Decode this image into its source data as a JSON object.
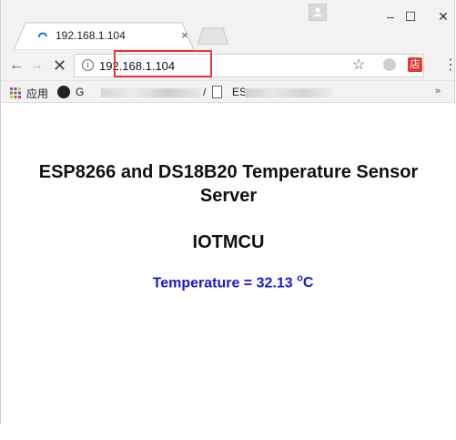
{
  "browser": {
    "tab": {
      "title": "192.168.1.104",
      "close_symbol": "×"
    },
    "window_controls": {
      "minimize": "–",
      "maximize": "☐",
      "close": "✕"
    },
    "toolbar": {
      "back": "←",
      "forward": "→",
      "stop": "✕",
      "info": "i",
      "url": "192.168.1.104",
      "star": "☆",
      "ext2": "店",
      "menu": "⋮"
    },
    "bookmarks": {
      "apps_label": "应用",
      "item1_label": "G",
      "item1_suffix": "/",
      "item2_label": "ES",
      "overflow": "»"
    },
    "colors": {
      "accent_highlight": "#e53935",
      "temperature_text": "#1a1acb"
    }
  },
  "page": {
    "heading": "ESP8266 and DS18B20 Temperature Sensor Server",
    "subheading": "IOTMCU",
    "temperature_label": "Temperature = ",
    "temperature_value": "32.13",
    "temperature_unit_sup": "o",
    "temperature_unit": "C"
  }
}
